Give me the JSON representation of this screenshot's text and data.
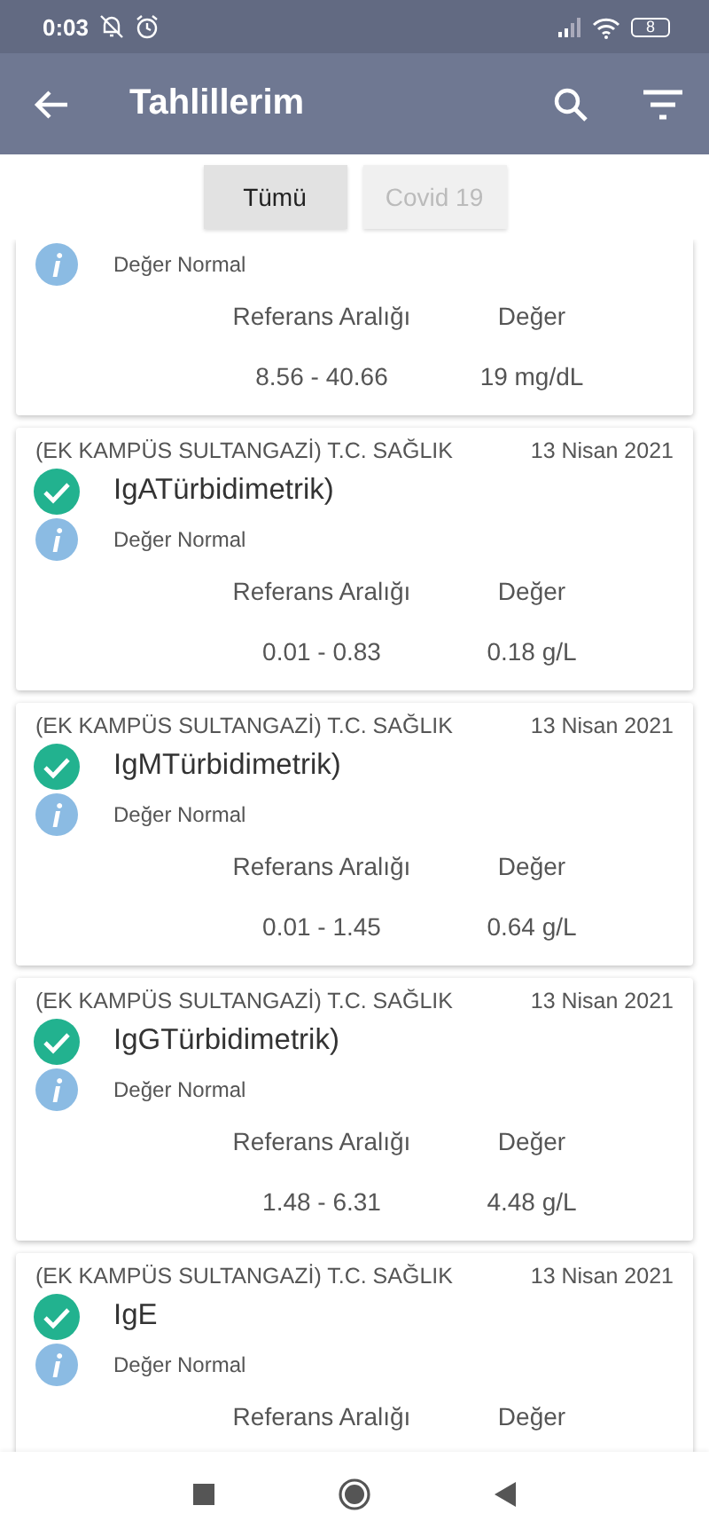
{
  "status_bar": {
    "time": "0:03",
    "battery": "8"
  },
  "app_bar": {
    "title": "Tahlillerim"
  },
  "tabs": [
    {
      "label": "Tümü",
      "selected": true
    },
    {
      "label": "Covid 19",
      "selected": false
    }
  ],
  "results": [
    {
      "status": "Değer Normal",
      "range_header": "Referans Aralığı",
      "value_header": "Değer",
      "range": "8.56 - 40.66",
      "value": "19 mg/dL"
    },
    {
      "hospital": "(EK KAMPÜS SULTANGAZİ) T.C. SAĞLIK",
      "date": "13 Nisan 2021",
      "name": "IgATürbidimetrik)",
      "status": "Değer Normal",
      "range_header": "Referans Aralığı",
      "value_header": "Değer",
      "range": "0.01 - 0.83",
      "value": "0.18 g/L"
    },
    {
      "hospital": "(EK KAMPÜS SULTANGAZİ) T.C. SAĞLIK",
      "date": "13 Nisan 2021",
      "name": "IgMTürbidimetrik)",
      "status": "Değer Normal",
      "range_header": "Referans Aralığı",
      "value_header": "Değer",
      "range": "0.01 - 1.45",
      "value": "0.64 g/L"
    },
    {
      "hospital": "(EK KAMPÜS SULTANGAZİ) T.C. SAĞLIK",
      "date": "13 Nisan 2021",
      "name": "IgGTürbidimetrik)",
      "status": "Değer Normal",
      "range_header": "Referans Aralığı",
      "value_header": "Değer",
      "range": "1.48 - 6.31",
      "value": "4.48 g/L"
    },
    {
      "hospital": "(EK KAMPÜS SULTANGAZİ) T.C. SAĞLIK",
      "date": "13 Nisan 2021",
      "name": "IgE",
      "status": "Değer Normal",
      "range_header": "Referans Aralığı",
      "value_header": "Değer"
    }
  ]
}
